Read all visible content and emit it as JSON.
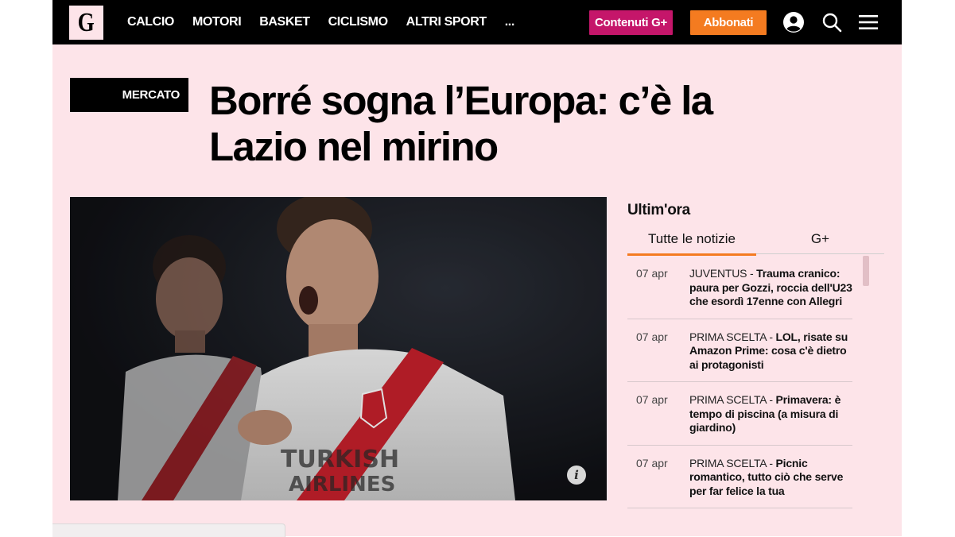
{
  "header": {
    "logo_letter": "G",
    "nav": [
      "CALCIO",
      "MOTORI",
      "BASKET",
      "CICLISMO",
      "ALTRI SPORT",
      "..."
    ],
    "plus_button": "Contenuti G+",
    "subscribe_button": "Abbonati",
    "icons": [
      "user-icon",
      "search-icon",
      "menu-icon"
    ],
    "colors": {
      "plus": "#c5166a",
      "subscribe": "#f47b20",
      "bar": "#000000"
    }
  },
  "article": {
    "tag": "MERCATO",
    "headline": "Borré sogna l’Europa: c’è la Lazio nel mirino",
    "info_glyph": "i"
  },
  "sidebar": {
    "title": "Ultim'ora",
    "tabs": [
      "Tutte le notizie",
      "G+"
    ],
    "items": [
      {
        "date": "07 apr",
        "category": "JUVENTUS",
        "title": "Trauma cranico: paura per Gozzi, roccia dell'U23 che esordì 17enne con Allegri"
      },
      {
        "date": "07 apr",
        "category": "PRIMA SCELTA",
        "title": "LOL, risate su Amazon Prime: cosa c'è dietro ai protagonisti"
      },
      {
        "date": "07 apr",
        "category": "PRIMA SCELTA",
        "title": "Primavera: è tempo di piscina (a misura di giardino)"
      },
      {
        "date": "07 apr",
        "category": "PRIMA SCELTA",
        "title": "Picnic romantico, tutto ciò che serve per far felice la tua"
      }
    ]
  },
  "page": {
    "background": "#fde4e9"
  }
}
